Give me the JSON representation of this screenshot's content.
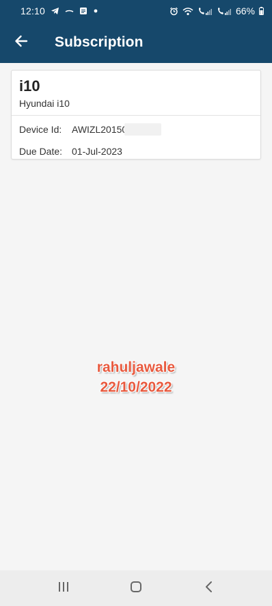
{
  "status_bar": {
    "time": "12:10",
    "battery": "66%",
    "left_icons": [
      "telegram-icon",
      "minus-icon",
      "document-icon",
      "dot-icon"
    ],
    "right_icons": [
      "alarm-icon",
      "wifi-icon",
      "call-signal-icon",
      "call-signal-icon",
      "battery-icon"
    ]
  },
  "app_bar": {
    "title": "Subscription",
    "back_icon": "arrow-left-icon",
    "background": "#16486b"
  },
  "subscription": {
    "title": "i10",
    "subtitle": "Hyundai i10",
    "device_label": "Device Id:",
    "device_value": "AWIZL20150",
    "due_label": "Due Date:",
    "due_value": "01-Jul-2023"
  },
  "watermark": {
    "line1": "rahuljawale",
    "line2": "22/10/2022",
    "color": "#e85a3f"
  },
  "nav_bar": {
    "icons": [
      "recent-apps-icon",
      "home-icon",
      "back-icon"
    ]
  }
}
